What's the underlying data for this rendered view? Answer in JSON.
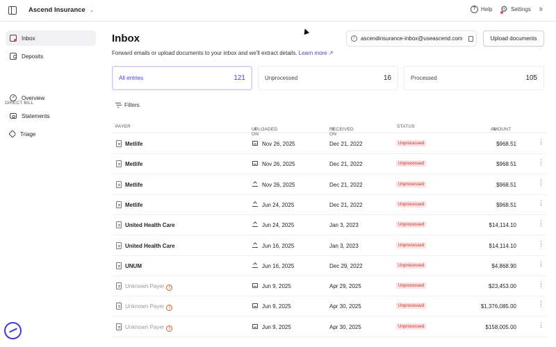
{
  "topbar": {
    "org_name": "Ascend Insurance",
    "help_label": "Help",
    "settings_label": "Settings",
    "user_initials": "Ir"
  },
  "sidebar": {
    "items": [
      {
        "label": "Inbox",
        "icon": "inbox-icon",
        "active": true
      },
      {
        "label": "Deposits",
        "icon": "wallet-icon",
        "active": false
      }
    ],
    "section_label": "DIRECT BILL",
    "direct_bill_items": [
      {
        "label": "Overview",
        "icon": "gauge-icon"
      },
      {
        "label": "Statements",
        "icon": "banknote-icon"
      },
      {
        "label": "Triage",
        "icon": "tag-icon"
      }
    ]
  },
  "main": {
    "title": "Inbox",
    "subtitle": "Forward emails or upload documents to your inbox and we'll extract details.",
    "learn_more": "Learn more ↗",
    "inbox_email": "ascendinsurance-inbox@useascend.com",
    "upload_button": "Upload documents",
    "stats": [
      {
        "label": "All entries",
        "count": "121",
        "active": true
      },
      {
        "label": "Unprocessed",
        "count": "16",
        "active": false
      },
      {
        "label": "Processed",
        "count": "105",
        "active": false
      }
    ],
    "filters_label": "Filters",
    "columns": {
      "payer": "PAYER",
      "uploaded_on": "UPLOADED ON",
      "received_on": "RECEIVED ON",
      "status": "STATUS",
      "amount": "AMOUNT"
    },
    "rows": [
      {
        "payer": "Metlife",
        "known": true,
        "source": "email",
        "uploaded": "Nov 26, 2025",
        "received": "Dec 21, 2022",
        "status": "Unprocessed",
        "amount": "$968.51"
      },
      {
        "payer": "Metlife",
        "known": true,
        "source": "email",
        "uploaded": "Nov 26, 2025",
        "received": "Dec 21, 2022",
        "status": "Unprocessed",
        "amount": "$968.51"
      },
      {
        "payer": "Metlife",
        "known": true,
        "source": "upload",
        "uploaded": "Nov 26, 2025",
        "received": "Dec 21, 2022",
        "status": "Unprocessed",
        "amount": "$968.51"
      },
      {
        "payer": "Metlife",
        "known": true,
        "source": "upload",
        "uploaded": "Jun 24, 2025",
        "received": "Dec 21, 2022",
        "status": "Unprocessed",
        "amount": "$968.51"
      },
      {
        "payer": "United Health Care",
        "known": true,
        "source": "upload",
        "uploaded": "Jun 24, 2025",
        "received": "Jan 3, 2023",
        "status": "Unprocessed",
        "amount": "$14,114.10"
      },
      {
        "payer": "United Health Care",
        "known": true,
        "source": "upload",
        "uploaded": "Jun 16, 2025",
        "received": "Jan 3, 2023",
        "status": "Unprocessed",
        "amount": "$14,114.10"
      },
      {
        "payer": "UNUM",
        "known": true,
        "source": "upload",
        "uploaded": "Jun 16, 2025",
        "received": "Dec 29, 2022",
        "status": "Unprocessed",
        "amount": "$4,868.90"
      },
      {
        "payer": "Unknown Payer",
        "known": false,
        "source": "email",
        "uploaded": "Jun 9, 2025",
        "received": "Apr 29, 2025",
        "status": "Unprocessed",
        "amount": "$23,453.00"
      },
      {
        "payer": "Unknown Payer",
        "known": false,
        "source": "email",
        "uploaded": "Jun 9, 2025",
        "received": "Apr 30, 2025",
        "status": "Unprocessed",
        "amount": "$1,376,085.00"
      },
      {
        "payer": "Unknown Payer",
        "known": false,
        "source": "email",
        "uploaded": "Jun 9, 2025",
        "received": "Apr 30, 2025",
        "status": "Unprocessed",
        "amount": "$158,005.00"
      }
    ]
  },
  "colors": {
    "accent": "#4a3fd6",
    "status_bg": "#fde2e2",
    "status_text": "#c4332e",
    "warning": "#d35b2a"
  }
}
